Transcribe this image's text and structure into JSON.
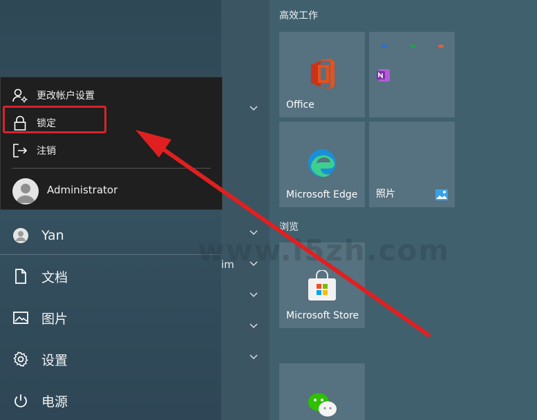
{
  "left_rail": {
    "user_name": "Yan",
    "items": [
      {
        "label": "文档",
        "icon": "document-icon"
      },
      {
        "label": "图片",
        "icon": "picture-icon"
      },
      {
        "label": "设置",
        "icon": "gear-icon"
      },
      {
        "label": "电源",
        "icon": "power-icon"
      }
    ]
  },
  "account_popup": {
    "items": [
      {
        "label": "更改帐户设置",
        "icon": "account-settings-icon"
      },
      {
        "label": "锁定",
        "icon": "lock-icon"
      },
      {
        "label": "注销",
        "icon": "sign-out-icon"
      }
    ],
    "other_user": "Administrator"
  },
  "app_list": {
    "partial_label": "im"
  },
  "tiles": {
    "group1_title": "高效工作",
    "group2_title": "浏览",
    "office_label": "Office",
    "edge_label": "Microsoft Edge",
    "photos_label": "照片",
    "store_label": "Microsoft Store"
  },
  "watermark": "www.i5zh.com",
  "colors": {
    "highlight": "#d8232a",
    "arrow": "#e02020",
    "popup_bg": "#1f1f1f"
  }
}
